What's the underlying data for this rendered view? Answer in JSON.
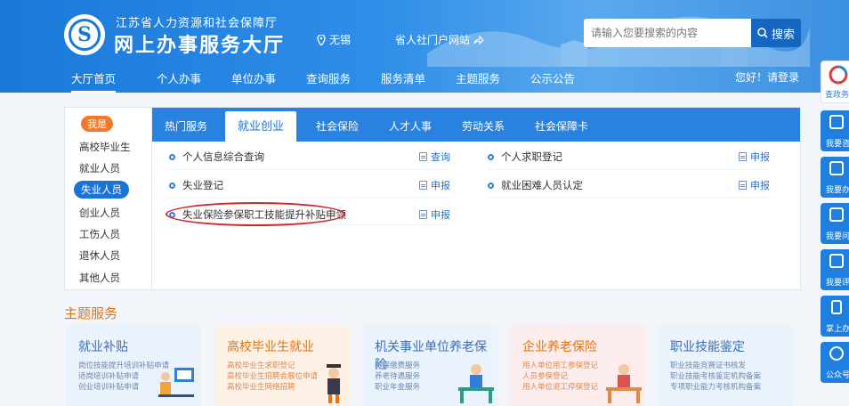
{
  "header": {
    "org_name": "江苏省人力资源和社会保障厅",
    "site_title": "网上办事服务大厅",
    "location": "无锡",
    "portal_link": "省人社门户网站",
    "search_placeholder": "请输入您要搜索的内容",
    "search_button": "搜索",
    "login_text": "您好！请登录"
  },
  "nav": [
    "大厅首页",
    "个人办事",
    "单位办事",
    "查询服务",
    "服务清单",
    "主题服务",
    "公示公告"
  ],
  "panel": {
    "hot_tag": "我是",
    "categories": [
      "高校毕业生",
      "就业人员",
      "失业人员",
      "创业人员",
      "工伤人员",
      "退休人员",
      "其他人员"
    ],
    "tabs": [
      "热门服务",
      "就业创业",
      "社会保险",
      "人才人事",
      "劳动关系",
      "社会保障卡"
    ],
    "services": [
      {
        "name": "个人信息综合查询",
        "action": "查询"
      },
      {
        "name": "个人求职登记",
        "action": "申报"
      },
      {
        "name": "失业登记",
        "action": "申报"
      },
      {
        "name": "就业困难人员认定",
        "action": "申报"
      },
      {
        "name": "失业保险参保职工技能提升补贴申领",
        "action": "申报"
      }
    ]
  },
  "theme": {
    "title": "主题服务",
    "cards": [
      {
        "title": "就业补贴",
        "lines": [
          "岗位技能提升培训补贴申请",
          "适岗培训补贴申请",
          "创业培训补贴申请"
        ],
        "color": "#3a6fb8"
      },
      {
        "title": "高校毕业生就业",
        "lines": [
          "高校毕业生求职登记",
          "高校毕业生招聘会展位申请",
          "高校毕业生网络招聘"
        ],
        "color": "#e8730d"
      },
      {
        "title": "机关事业单位养老保险",
        "lines": [
          "参保缴费服务",
          "养老待遇服务",
          "职业年金服务"
        ],
        "color": "#3a6fb8"
      },
      {
        "title": "企业养老保险",
        "lines": [
          "用人单位用工参保登记",
          "人员参保登记",
          "用人单位退工停保登记"
        ],
        "color": "#e8730d"
      },
      {
        "title": "职业技能鉴定",
        "lines": [
          "职业技能竞赛证书核发",
          "职业技能考核鉴定机构备案",
          "专项职业能力考核机构备案"
        ],
        "color": "#3a6fb8"
      }
    ]
  },
  "sidebar": [
    "查政务服",
    "我要咨",
    "我要办",
    "我要问",
    "我要评",
    "掌上办",
    "公众号"
  ]
}
